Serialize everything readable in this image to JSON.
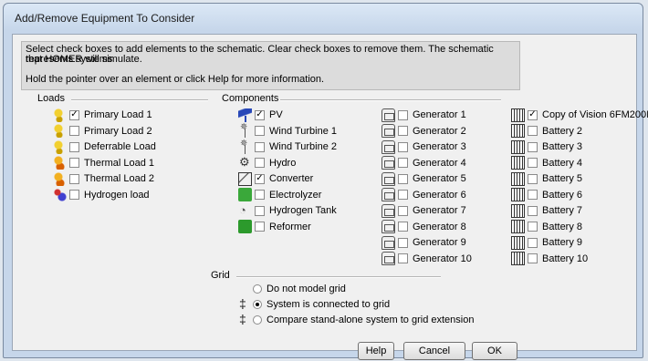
{
  "window": {
    "title": "Add/Remove Equipment To Consider"
  },
  "info": {
    "line1": "Select check boxes to add elements to the schematic. Clear check boxes to remove them. The schematic represents systems",
    "line2": "that HOMER will simulate.",
    "line3": "Hold the pointer over an element or click Help for more information."
  },
  "loads": {
    "label": "Loads",
    "items": [
      {
        "label": "Primary Load 1",
        "checked": true,
        "icon": "primary-load-icon"
      },
      {
        "label": "Primary Load 2",
        "checked": false,
        "icon": "primary-load-icon"
      },
      {
        "label": "Deferrable Load",
        "checked": false,
        "icon": "deferrable-load-icon"
      },
      {
        "label": "Thermal Load 1",
        "checked": false,
        "icon": "thermal-load-icon"
      },
      {
        "label": "Thermal Load 2",
        "checked": false,
        "icon": "thermal-load-icon"
      },
      {
        "label": "Hydrogen load",
        "checked": false,
        "icon": "hydrogen-load-icon"
      }
    ]
  },
  "components": {
    "label": "Components",
    "col1": [
      {
        "label": "PV",
        "checked": true,
        "icon": "pv-icon"
      },
      {
        "label": "Wind Turbine 1",
        "checked": false,
        "icon": "wind-turbine-icon"
      },
      {
        "label": "Wind Turbine 2",
        "checked": false,
        "icon": "wind-turbine-icon"
      },
      {
        "label": "Hydro",
        "checked": false,
        "icon": "hydro-icon"
      },
      {
        "label": "Converter",
        "checked": true,
        "icon": "converter-icon"
      },
      {
        "label": "Electrolyzer",
        "checked": false,
        "icon": "electrolyzer-icon"
      },
      {
        "label": "Hydrogen Tank",
        "checked": false,
        "icon": "hydrogen-tank-icon"
      },
      {
        "label": "Reformer",
        "checked": false,
        "icon": "reformer-icon"
      }
    ],
    "generators": [
      {
        "label": "Generator 1",
        "checked": false
      },
      {
        "label": "Generator 2",
        "checked": false
      },
      {
        "label": "Generator 3",
        "checked": false
      },
      {
        "label": "Generator 4",
        "checked": false
      },
      {
        "label": "Generator 5",
        "checked": false
      },
      {
        "label": "Generator 6",
        "checked": false
      },
      {
        "label": "Generator 7",
        "checked": false
      },
      {
        "label": "Generator 8",
        "checked": false
      },
      {
        "label": "Generator 9",
        "checked": false
      },
      {
        "label": "Generator 10",
        "checked": false
      }
    ],
    "batteries": [
      {
        "label": "Copy of Vision 6FM200I",
        "checked": true
      },
      {
        "label": "Battery 2",
        "checked": false
      },
      {
        "label": "Battery 3",
        "checked": false
      },
      {
        "label": "Battery 4",
        "checked": false
      },
      {
        "label": "Battery 5",
        "checked": false
      },
      {
        "label": "Battery 6",
        "checked": false
      },
      {
        "label": "Battery 7",
        "checked": false
      },
      {
        "label": "Battery 8",
        "checked": false
      },
      {
        "label": "Battery 9",
        "checked": false
      },
      {
        "label": "Battery 10",
        "checked": false
      }
    ]
  },
  "grid": {
    "label": "Grid",
    "options": [
      {
        "label": "Do not model grid",
        "selected": false
      },
      {
        "label": "System is connected to grid",
        "selected": true
      },
      {
        "label": "Compare stand-alone system to grid extension",
        "selected": false
      }
    ]
  },
  "buttons": {
    "help": "Help",
    "cancel": "Cancel",
    "ok": "OK"
  },
  "checkmark": "✓"
}
